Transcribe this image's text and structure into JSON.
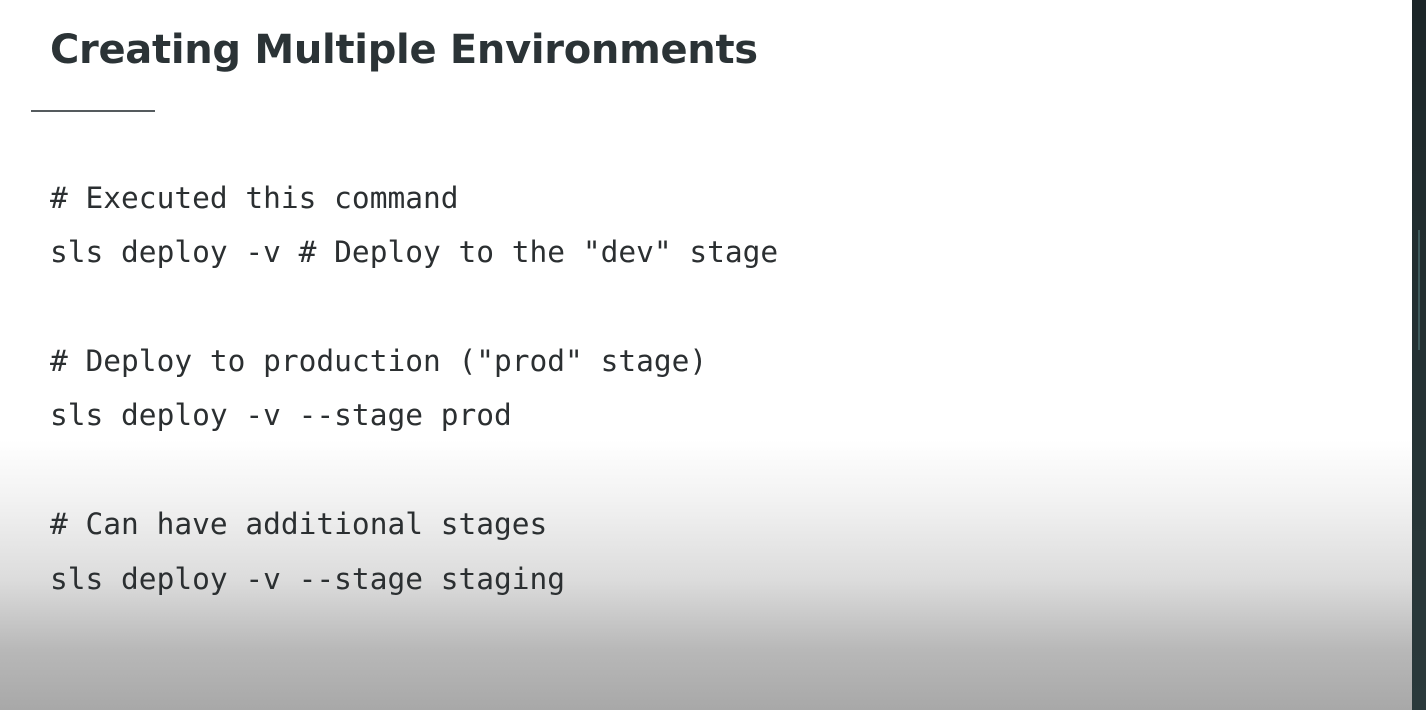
{
  "slide": {
    "title": "Creating Multiple Environments",
    "code_lines": [
      "# Executed this command",
      "sls deploy -v # Deploy to the \"dev\" stage",
      "# Deploy to production (\"prod\" stage)",
      "sls deploy -v --stage prod",
      "# Can have additional stages",
      "sls deploy -v --stage staging"
    ]
  },
  "colors": {
    "title": "#2b3336",
    "code_text": "#2b2f31",
    "rule": "#555b5e",
    "background": "#ffffff"
  }
}
